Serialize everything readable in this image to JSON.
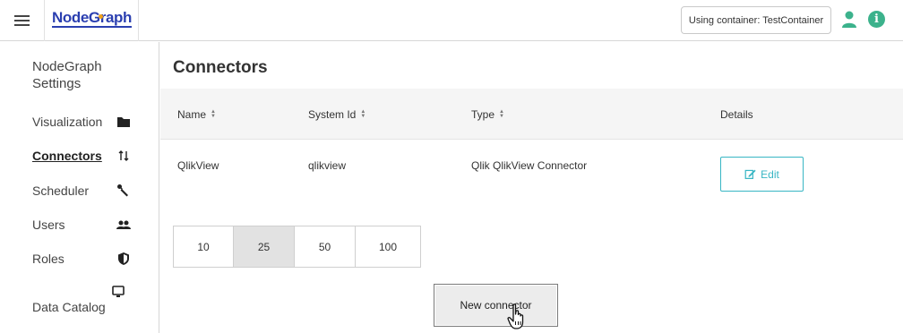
{
  "header": {
    "logo": "NodeGraph",
    "container_label": "Using container: TestContainer",
    "icons": [
      "menu-icon",
      "user-icon",
      "info-icon"
    ],
    "accent_color": "#3cb28c",
    "logo_color": "#2b3fb0"
  },
  "sidebar": {
    "title": "NodeGraph Settings",
    "items": [
      {
        "label": "Visualization",
        "icon": "folder-icon",
        "active": false
      },
      {
        "label": "Connectors",
        "icon": "arrows-icon",
        "active": true
      },
      {
        "label": "Scheduler",
        "icon": "wrench-icon",
        "active": false
      },
      {
        "label": "Users",
        "icon": "users-icon",
        "active": false
      },
      {
        "label": "Roles",
        "icon": "shield-icon",
        "active": false
      },
      {
        "label": "Data Catalog",
        "icon": "monitor-icon",
        "active": false
      }
    ]
  },
  "main": {
    "title": "Connectors",
    "columns": [
      "Name",
      "System Id",
      "Type",
      "Details"
    ],
    "rows": [
      {
        "name": "QlikView",
        "system_id": "qlikview",
        "type": "Qlik QlikView Connector",
        "action": "Edit"
      }
    ],
    "page_sizes": [
      "10",
      "25",
      "50",
      "100"
    ],
    "selected_page_size": "25",
    "new_button": "New connector",
    "edit_color": "#38b6c4"
  }
}
